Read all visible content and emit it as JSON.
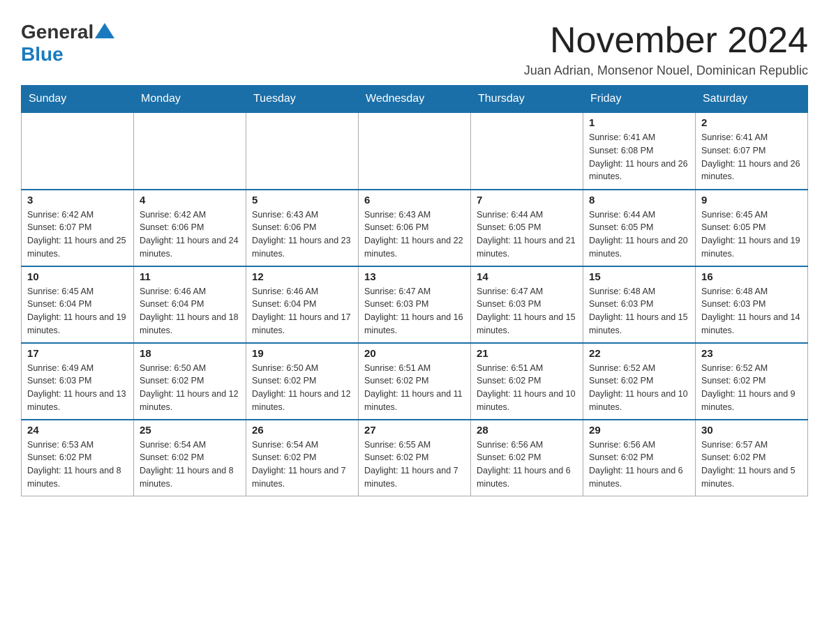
{
  "logo": {
    "general": "General",
    "blue": "Blue"
  },
  "header": {
    "month_title": "November 2024",
    "location": "Juan Adrian, Monsenor Nouel, Dominican Republic"
  },
  "weekdays": [
    "Sunday",
    "Monday",
    "Tuesday",
    "Wednesday",
    "Thursday",
    "Friday",
    "Saturday"
  ],
  "weeks": [
    [
      {
        "day": "",
        "info": ""
      },
      {
        "day": "",
        "info": ""
      },
      {
        "day": "",
        "info": ""
      },
      {
        "day": "",
        "info": ""
      },
      {
        "day": "",
        "info": ""
      },
      {
        "day": "1",
        "info": "Sunrise: 6:41 AM\nSunset: 6:08 PM\nDaylight: 11 hours and 26 minutes."
      },
      {
        "day": "2",
        "info": "Sunrise: 6:41 AM\nSunset: 6:07 PM\nDaylight: 11 hours and 26 minutes."
      }
    ],
    [
      {
        "day": "3",
        "info": "Sunrise: 6:42 AM\nSunset: 6:07 PM\nDaylight: 11 hours and 25 minutes."
      },
      {
        "day": "4",
        "info": "Sunrise: 6:42 AM\nSunset: 6:06 PM\nDaylight: 11 hours and 24 minutes."
      },
      {
        "day": "5",
        "info": "Sunrise: 6:43 AM\nSunset: 6:06 PM\nDaylight: 11 hours and 23 minutes."
      },
      {
        "day": "6",
        "info": "Sunrise: 6:43 AM\nSunset: 6:06 PM\nDaylight: 11 hours and 22 minutes."
      },
      {
        "day": "7",
        "info": "Sunrise: 6:44 AM\nSunset: 6:05 PM\nDaylight: 11 hours and 21 minutes."
      },
      {
        "day": "8",
        "info": "Sunrise: 6:44 AM\nSunset: 6:05 PM\nDaylight: 11 hours and 20 minutes."
      },
      {
        "day": "9",
        "info": "Sunrise: 6:45 AM\nSunset: 6:05 PM\nDaylight: 11 hours and 19 minutes."
      }
    ],
    [
      {
        "day": "10",
        "info": "Sunrise: 6:45 AM\nSunset: 6:04 PM\nDaylight: 11 hours and 19 minutes."
      },
      {
        "day": "11",
        "info": "Sunrise: 6:46 AM\nSunset: 6:04 PM\nDaylight: 11 hours and 18 minutes."
      },
      {
        "day": "12",
        "info": "Sunrise: 6:46 AM\nSunset: 6:04 PM\nDaylight: 11 hours and 17 minutes."
      },
      {
        "day": "13",
        "info": "Sunrise: 6:47 AM\nSunset: 6:03 PM\nDaylight: 11 hours and 16 minutes."
      },
      {
        "day": "14",
        "info": "Sunrise: 6:47 AM\nSunset: 6:03 PM\nDaylight: 11 hours and 15 minutes."
      },
      {
        "day": "15",
        "info": "Sunrise: 6:48 AM\nSunset: 6:03 PM\nDaylight: 11 hours and 15 minutes."
      },
      {
        "day": "16",
        "info": "Sunrise: 6:48 AM\nSunset: 6:03 PM\nDaylight: 11 hours and 14 minutes."
      }
    ],
    [
      {
        "day": "17",
        "info": "Sunrise: 6:49 AM\nSunset: 6:03 PM\nDaylight: 11 hours and 13 minutes."
      },
      {
        "day": "18",
        "info": "Sunrise: 6:50 AM\nSunset: 6:02 PM\nDaylight: 11 hours and 12 minutes."
      },
      {
        "day": "19",
        "info": "Sunrise: 6:50 AM\nSunset: 6:02 PM\nDaylight: 11 hours and 12 minutes."
      },
      {
        "day": "20",
        "info": "Sunrise: 6:51 AM\nSunset: 6:02 PM\nDaylight: 11 hours and 11 minutes."
      },
      {
        "day": "21",
        "info": "Sunrise: 6:51 AM\nSunset: 6:02 PM\nDaylight: 11 hours and 10 minutes."
      },
      {
        "day": "22",
        "info": "Sunrise: 6:52 AM\nSunset: 6:02 PM\nDaylight: 11 hours and 10 minutes."
      },
      {
        "day": "23",
        "info": "Sunrise: 6:52 AM\nSunset: 6:02 PM\nDaylight: 11 hours and 9 minutes."
      }
    ],
    [
      {
        "day": "24",
        "info": "Sunrise: 6:53 AM\nSunset: 6:02 PM\nDaylight: 11 hours and 8 minutes."
      },
      {
        "day": "25",
        "info": "Sunrise: 6:54 AM\nSunset: 6:02 PM\nDaylight: 11 hours and 8 minutes."
      },
      {
        "day": "26",
        "info": "Sunrise: 6:54 AM\nSunset: 6:02 PM\nDaylight: 11 hours and 7 minutes."
      },
      {
        "day": "27",
        "info": "Sunrise: 6:55 AM\nSunset: 6:02 PM\nDaylight: 11 hours and 7 minutes."
      },
      {
        "day": "28",
        "info": "Sunrise: 6:56 AM\nSunset: 6:02 PM\nDaylight: 11 hours and 6 minutes."
      },
      {
        "day": "29",
        "info": "Sunrise: 6:56 AM\nSunset: 6:02 PM\nDaylight: 11 hours and 6 minutes."
      },
      {
        "day": "30",
        "info": "Sunrise: 6:57 AM\nSunset: 6:02 PM\nDaylight: 11 hours and 5 minutes."
      }
    ]
  ]
}
